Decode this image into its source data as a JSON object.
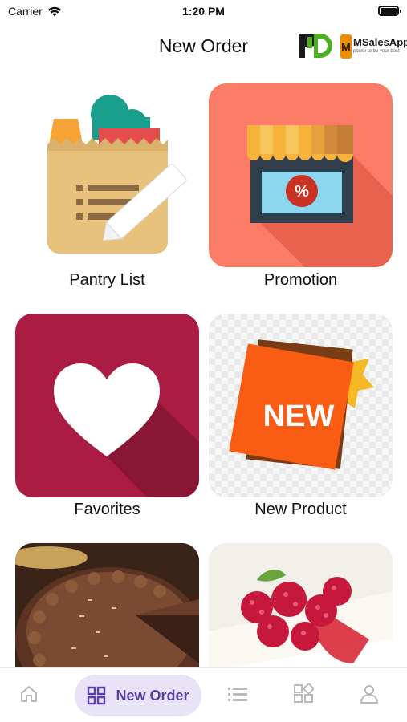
{
  "status_bar": {
    "carrier": "Carrier",
    "time": "1:20 PM"
  },
  "header": {
    "title": "New Order",
    "logo_pd": "PD",
    "logo_ms_name": "MSalesApp",
    "logo_ms_tagline": "power to be your best"
  },
  "tiles": [
    {
      "label": "Pantry List",
      "icon": "pantry-list-bag-icon"
    },
    {
      "label": "Promotion",
      "icon": "promotion-shop-icon"
    },
    {
      "label": "Favorites",
      "icon": "heart-icon"
    },
    {
      "label": "New Product",
      "icon": "new-badge-icon",
      "badge_text": "NEW"
    },
    {
      "label": "",
      "icon": "chocolate-cake-image"
    },
    {
      "label": "",
      "icon": "raspberry-cheesecake-image"
    }
  ],
  "bottom_nav": {
    "items": [
      {
        "name": "home",
        "icon": "home-icon"
      },
      {
        "name": "new-order",
        "icon": "grid-icon",
        "label": "New Order",
        "active": true
      },
      {
        "name": "list",
        "icon": "list-icon"
      },
      {
        "name": "categories",
        "icon": "categories-icon"
      },
      {
        "name": "profile",
        "icon": "profile-icon"
      }
    ]
  },
  "colors": {
    "accent": "#5b3fa6",
    "accent_bg": "#e9e3f8",
    "promotion_bg": "#fb7c66",
    "favorites_bg": "#aa1c43",
    "new_orange": "#f95c12"
  }
}
